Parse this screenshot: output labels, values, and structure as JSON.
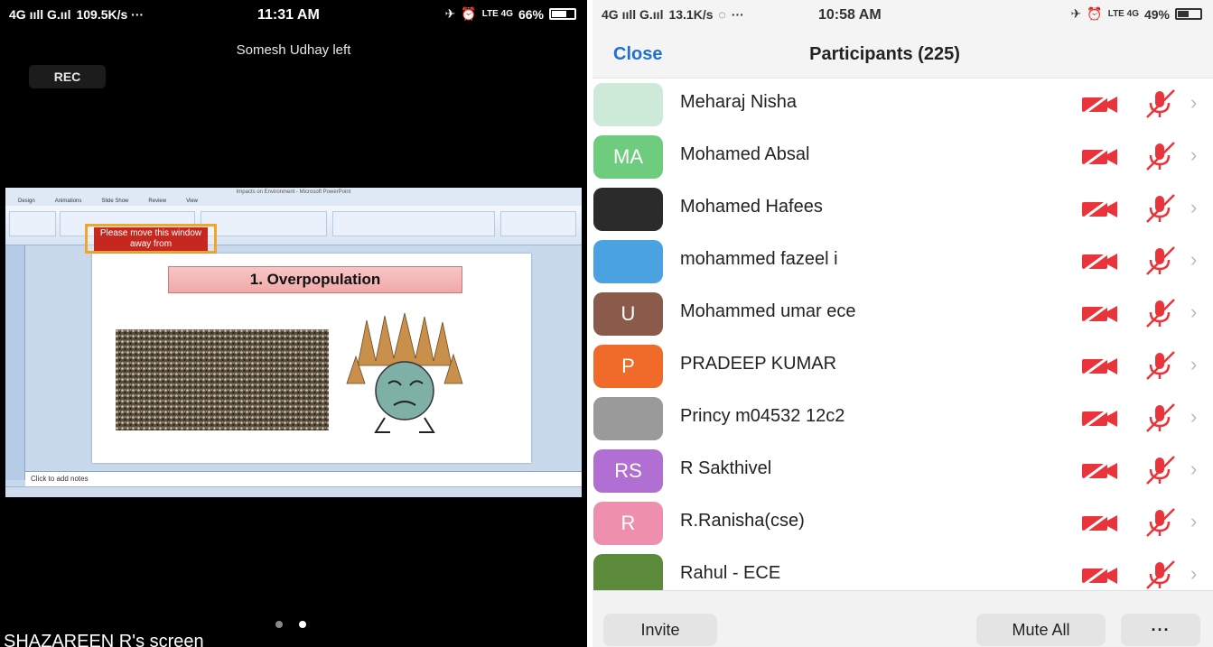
{
  "left_phone": {
    "status": {
      "network": "4G ııll G.ııl",
      "speed": "109.5K/s ···",
      "time": "11:31 AM",
      "battery": "66%"
    },
    "toast": "Somesh Udhay left",
    "rec_label": "REC",
    "shared_screen": {
      "window_title": "Impacts on Environment - Microsoft PowerPoint",
      "tabs": [
        "Design",
        "Animations",
        "Slide Show",
        "Review",
        "View"
      ],
      "warning": "Please move this window away from",
      "slide_title": "1. Overpopulation",
      "notes_placeholder": "Click to add notes"
    },
    "screen_owner": "SHAZAREEN R's screen"
  },
  "right_phone": {
    "status": {
      "network": "4G ııll G.ııl",
      "speed": "13.1K/s",
      "time": "10:58 AM",
      "battery": "49%"
    },
    "close_label": "Close",
    "title": "Participants (225)",
    "participants": [
      {
        "name": "Meharaj Nisha",
        "initials": "",
        "color": "#cde9d8"
      },
      {
        "name": "Mohamed Absal",
        "initials": "MA",
        "color": "#6dcc7d"
      },
      {
        "name": "Mohamed Hafees",
        "initials": "",
        "color": "#2b2b2b"
      },
      {
        "name": "mohammed fazeel i",
        "initials": "",
        "color": "#4aa3e0"
      },
      {
        "name": "Mohammed umar ece",
        "initials": "U",
        "color": "#8a5a4a"
      },
      {
        "name": "PRADEEP KUMAR",
        "initials": "P",
        "color": "#f06a2a"
      },
      {
        "name": "Princy m04532 12c2",
        "initials": "",
        "color": "#9a9a9a"
      },
      {
        "name": "R Sakthivel",
        "initials": "RS",
        "color": "#b16fd4"
      },
      {
        "name": "R.Ranisha(cse)",
        "initials": "R",
        "color": "#ef8fae"
      },
      {
        "name": "Rahul - ECE",
        "initials": "",
        "color": "#5b8a3a"
      }
    ],
    "invite_label": "Invite",
    "mute_all_label": "Mute All",
    "more_label": "···"
  },
  "icons": {
    "video_off": "video-off-icon",
    "mic_off": "mic-off-icon",
    "chevron": "chevron-right-icon"
  },
  "colors": {
    "accent": "#1f6fd6",
    "muted_red": "#e8343a"
  }
}
